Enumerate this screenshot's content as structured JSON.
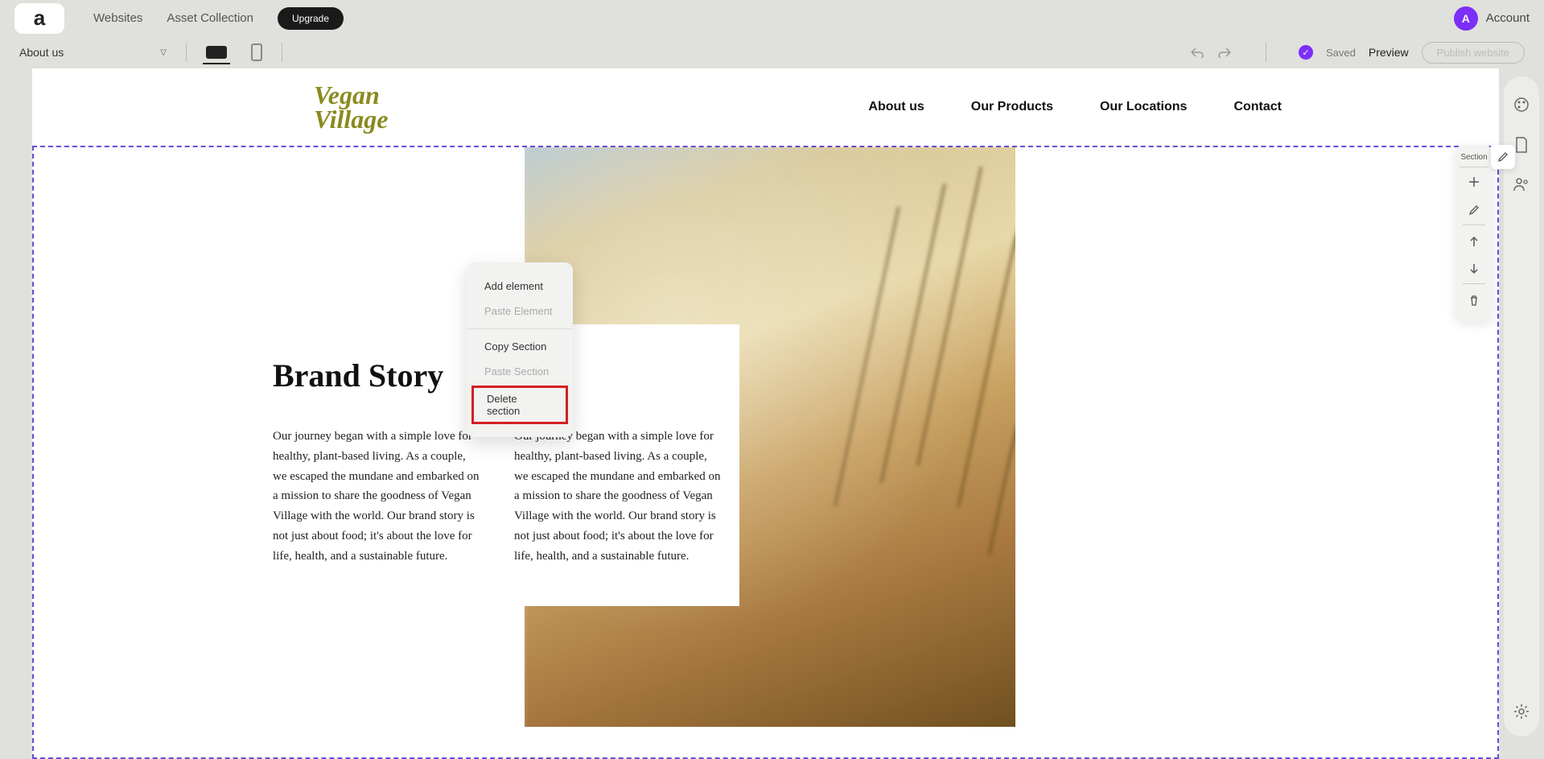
{
  "topbar": {
    "logo_letter": "a",
    "websites": "Websites",
    "asset_collection": "Asset Collection",
    "upgrade": "Upgrade",
    "avatar_letter": "A",
    "account": "Account"
  },
  "secondary": {
    "page_name": "About us",
    "saved": "Saved",
    "preview": "Preview",
    "publish": "Publish website"
  },
  "site": {
    "brand_line1": "Vegan",
    "brand_line2": "Village",
    "nav": {
      "about": "About us",
      "products": "Our Products",
      "locations": "Our Locations",
      "contact": "Contact"
    }
  },
  "section": {
    "heading": "Brand Story",
    "col1": "Our journey began with a simple love for healthy, plant-based living. As a couple, we escaped the mundane and embarked on a mission to share the goodness of Vegan Village with the world. Our brand story is not just about food; it's about the love for life, health, and a sustainable future.",
    "col2": "Our journey began with a simple love for healthy, plant-based living. As a couple, we escaped the mundane and embarked on a mission to share the goodness of Vegan Village with the world. Our brand story is not just about food; it's about the love for life, health, and a sustainable future."
  },
  "context_menu": {
    "add_element": "Add element",
    "paste_element": "Paste Element",
    "copy_section": "Copy Section",
    "paste_section": "Paste Section",
    "delete_section": "Delete section"
  },
  "section_toolbar": {
    "label": "Section"
  }
}
